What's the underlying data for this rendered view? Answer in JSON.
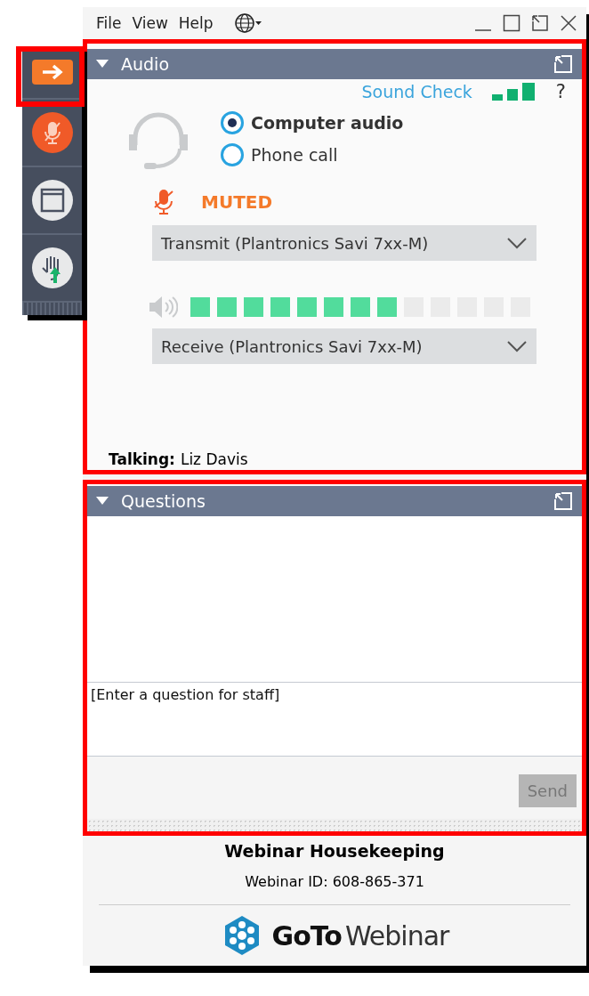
{
  "menu": [
    "File",
    "View",
    "Help"
  ],
  "sidebar": [
    {
      "kind": "arrow",
      "highlighted": true
    },
    {
      "kind": "mic",
      "highlighted": false
    },
    {
      "kind": "window",
      "highlighted": false
    },
    {
      "kind": "hand",
      "highlighted": false
    }
  ],
  "audio": {
    "title": "Audio",
    "highlighted": true,
    "sound_check": "Sound Check",
    "help": "?",
    "modes": [
      {
        "label": "Computer audio",
        "selected": true
      },
      {
        "label": "Phone call",
        "selected": false
      }
    ],
    "muted": true,
    "mic_status": "MUTED",
    "transmit": "Transmit (Plantronics Savi 7xx-M)",
    "speaker": {
      "level": 0.615
    },
    "receive": "Receive (Plantronics Savi 7xx-M)",
    "talking_label": "Talking:",
    "talking_name": "Liz Davis"
  },
  "questions": {
    "title": "Questions",
    "highlighted": true,
    "placeholder": "[Enter a question for staff]",
    "send": {
      "label": "Send",
      "disabled": true
    }
  },
  "footer": {
    "title": "Webinar Housekeeping",
    "webinar_id": "Webinar ID: 608-865-371",
    "brand_bold": "GoTo",
    "brand_light": "Webinar"
  }
}
